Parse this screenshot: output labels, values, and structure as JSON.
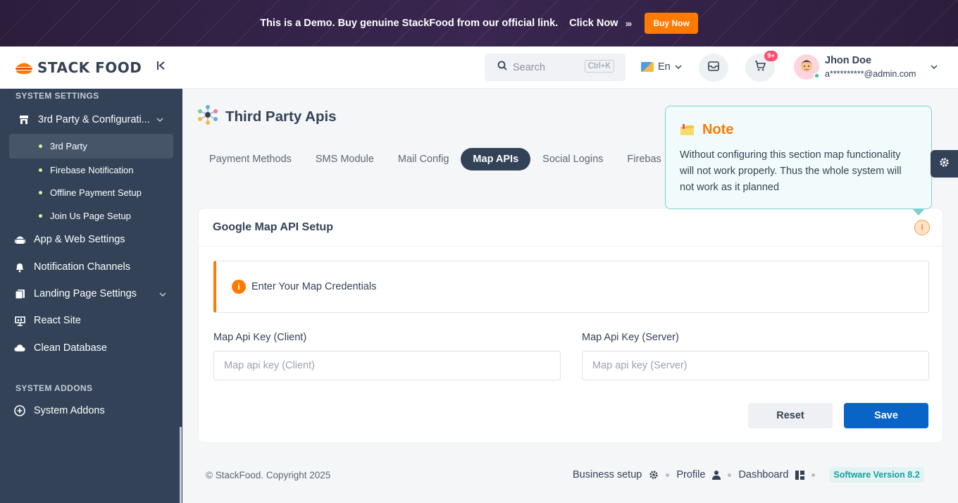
{
  "banner": {
    "text": "This is a Demo. Buy genuine StackFood from our official link.",
    "link_label": "Click Now",
    "arrows": "›››",
    "buy_label": "Buy Now"
  },
  "brand": {
    "logo_text": "STACK FOOD"
  },
  "sidebar": {
    "section_system_settings": "SYSTEM SETTINGS",
    "group_3rd_party": "3rd Party & Configurati...",
    "sub_items": [
      {
        "label": "3rd Party",
        "active": true
      },
      {
        "label": "Firebase Notification"
      },
      {
        "label": "Offline Payment Setup"
      },
      {
        "label": "Join Us Page Setup"
      }
    ],
    "items": [
      {
        "label": "App & Web Settings",
        "icon": "android-icon"
      },
      {
        "label": "Notification Channels",
        "icon": "bell-icon"
      },
      {
        "label": "Landing Page Settings",
        "icon": "pages-icon"
      },
      {
        "label": "React Site",
        "icon": "presentation-icon"
      },
      {
        "label": "Clean Database",
        "icon": "cloud-icon"
      }
    ],
    "section_system_addons": "SYSTEM ADDONS",
    "addons_item": "System Addons"
  },
  "header": {
    "search_placeholder": "Search",
    "search_shortcut": "Ctrl+K",
    "language": "En",
    "cart_badge": "9+",
    "user_name": "Jhon Doe",
    "user_email": "a**********@admin.com"
  },
  "page": {
    "title": "Third Party Apis",
    "tabs": [
      {
        "label": "Payment Methods"
      },
      {
        "label": "SMS Module"
      },
      {
        "label": "Mail Config"
      },
      {
        "label": "Map APIs",
        "active": true
      },
      {
        "label": "Social Logins"
      },
      {
        "label": "Firebas"
      }
    ]
  },
  "card": {
    "title": "Google Map API Setup",
    "alert_text": "Enter Your Map Credentials",
    "client_label": "Map Api Key (Client)",
    "client_placeholder": "Map api key (Client)",
    "server_label": "Map Api Key (Server)",
    "server_placeholder": "Map api key (Server)",
    "reset_label": "Reset",
    "save_label": "Save"
  },
  "note": {
    "title": "Note",
    "body": "Without configuring this section map functionality will not work properly. Thus the whole system will not work as it planned"
  },
  "footer": {
    "copyright": "© StackFood. Copyright 2025",
    "business_setup": "Business setup",
    "profile": "Profile",
    "dashboard": "Dashboard",
    "version": "Software Version 8.2"
  },
  "colors": {
    "sidebar_bg": "#334257",
    "accent_orange": "#ff7a00",
    "save_blue": "#0864c6",
    "note_border": "#7fcfcf"
  }
}
